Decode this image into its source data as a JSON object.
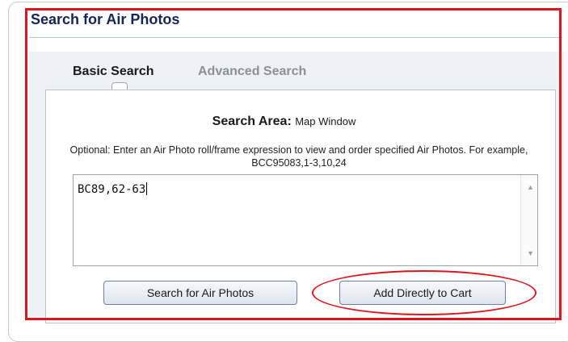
{
  "dialog": {
    "title": "Search for Air Photos"
  },
  "tabs": [
    {
      "label": "Basic Search",
      "active": true
    },
    {
      "label": "Advanced Search",
      "active": false
    }
  ],
  "search_area": {
    "label": "Search Area:",
    "value": "Map Window"
  },
  "instructions": "Optional: Enter an Air Photo roll/frame expression to view and order specified Air Photos. For example, BCC95083,1-3,10,24",
  "expression_input": {
    "value": "BC89,62-63"
  },
  "buttons": {
    "search": "Search for Air Photos",
    "add_to_cart": "Add Directly to Cart"
  },
  "colors": {
    "annotation_red": "#e0141e",
    "title_blue": "#14255a"
  }
}
